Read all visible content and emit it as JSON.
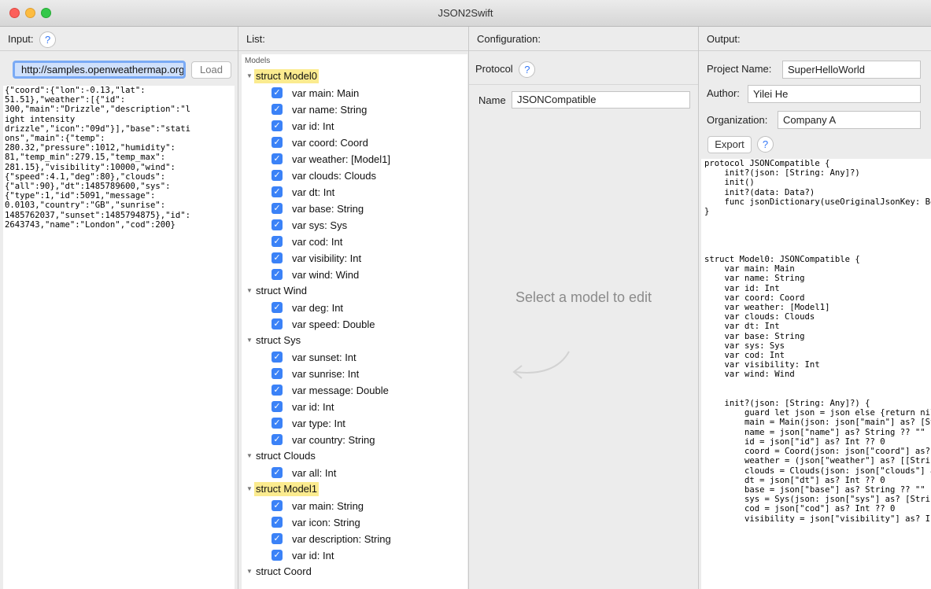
{
  "window": {
    "title": "JSON2Swift"
  },
  "input": {
    "header": "Input:",
    "url_value": "http://samples.openweathermap.org",
    "load_label": "Load",
    "json_text": "{\"coord\":{\"lon\":-0.13,\"lat\":\n51.51},\"weather\":[{\"id\":\n300,\"main\":\"Drizzle\",\"description\":\"l\night intensity\ndrizzle\",\"icon\":\"09d\"}],\"base\":\"stati\nons\",\"main\":{\"temp\":\n280.32,\"pressure\":1012,\"humidity\":\n81,\"temp_min\":279.15,\"temp_max\":\n281.15},\"visibility\":10000,\"wind\":\n{\"speed\":4.1,\"deg\":80},\"clouds\":\n{\"all\":90},\"dt\":1485789600,\"sys\":\n{\"type\":1,\"id\":5091,\"message\":\n0.0103,\"country\":\"GB\",\"sunrise\":\n1485762037,\"sunset\":1485794875},\"id\":\n2643743,\"name\":\"London\",\"cod\":200}"
  },
  "list": {
    "header": "List:",
    "caption": "Models",
    "rows": [
      {
        "kind": "struct",
        "label": "struct Model0",
        "highlight": true
      },
      {
        "kind": "prop",
        "label": "var main: Main",
        "checked": true
      },
      {
        "kind": "prop",
        "label": "var name: String",
        "checked": true
      },
      {
        "kind": "prop",
        "label": "var id: Int",
        "checked": true
      },
      {
        "kind": "prop",
        "label": "var coord: Coord",
        "checked": true
      },
      {
        "kind": "prop",
        "label": "var weather: [Model1]",
        "checked": true
      },
      {
        "kind": "prop",
        "label": "var clouds: Clouds",
        "checked": true
      },
      {
        "kind": "prop",
        "label": "var dt: Int",
        "checked": true
      },
      {
        "kind": "prop",
        "label": "var base: String",
        "checked": true
      },
      {
        "kind": "prop",
        "label": "var sys: Sys",
        "checked": true
      },
      {
        "kind": "prop",
        "label": "var cod: Int",
        "checked": true
      },
      {
        "kind": "prop",
        "label": "var visibility: Int",
        "checked": true
      },
      {
        "kind": "prop",
        "label": "var wind: Wind",
        "checked": true
      },
      {
        "kind": "struct",
        "label": "struct Wind",
        "highlight": false
      },
      {
        "kind": "prop",
        "label": "var deg: Int",
        "checked": true
      },
      {
        "kind": "prop",
        "label": "var speed: Double",
        "checked": true
      },
      {
        "kind": "struct",
        "label": "struct Sys",
        "highlight": false
      },
      {
        "kind": "prop",
        "label": "var sunset: Int",
        "checked": true
      },
      {
        "kind": "prop",
        "label": "var sunrise: Int",
        "checked": true
      },
      {
        "kind": "prop",
        "label": "var message: Double",
        "checked": true
      },
      {
        "kind": "prop",
        "label": "var id: Int",
        "checked": true
      },
      {
        "kind": "prop",
        "label": "var type: Int",
        "checked": true
      },
      {
        "kind": "prop",
        "label": "var country: String",
        "checked": true
      },
      {
        "kind": "struct",
        "label": "struct Clouds",
        "highlight": false
      },
      {
        "kind": "prop",
        "label": "var all: Int",
        "checked": true
      },
      {
        "kind": "struct",
        "label": "struct Model1",
        "highlight": true
      },
      {
        "kind": "prop",
        "label": "var main: String",
        "checked": true
      },
      {
        "kind": "prop",
        "label": "var icon: String",
        "checked": true
      },
      {
        "kind": "prop",
        "label": "var description: String",
        "checked": true
      },
      {
        "kind": "prop",
        "label": "var id: Int",
        "checked": true
      },
      {
        "kind": "struct",
        "label": "struct Coord",
        "highlight": false
      }
    ]
  },
  "configuration": {
    "header": "Configuration:",
    "protocol_label": "Protocol",
    "name_label": "Name",
    "name_value": "JSONCompatible",
    "placeholder": "Select a model to edit"
  },
  "output": {
    "header": "Output:",
    "project_label": "Project Name:",
    "project_value": "SuperHelloWorld",
    "author_label": "Author:",
    "author_value": "Yilei He",
    "org_label": "Organization:",
    "org_value": "Company A",
    "export_label": "Export",
    "code_text": "protocol JSONCompatible {\n    init?(json: [String: Any]?)\n    init()\n    init?(data: Data?)\n    func jsonDictionary(useOriginalJsonKey: Bool) -> [String: Any]\n}\n\n\n\n\nstruct Model0: JSONCompatible {\n    var main: Main\n    var name: String\n    var id: Int\n    var coord: Coord\n    var weather: [Model1]\n    var clouds: Clouds\n    var dt: Int\n    var base: String\n    var sys: Sys\n    var cod: Int\n    var visibility: Int\n    var wind: Wind\n\n\n    init?(json: [String: Any]?) {\n        guard let json = json else {return nil}\n        main = Main(json: json[\"main\"] as? [String: Any]) ?? Main()\n        name = json[\"name\"] as? String ?? \"\"\n        id = json[\"id\"] as? Int ?? 0\n        coord = Coord(json: json[\"coord\"] as? [String: Any]) ?? Coord()\n        weather = (json[\"weather\"] as? [[String: Any]] ?? []).flatMap{Model1(json: $0)}\n        clouds = Clouds(json: json[\"clouds\"] as? [String: Any]) ?? Clouds()\n        dt = json[\"dt\"] as? Int ?? 0\n        base = json[\"base\"] as? String ?? \"\"\n        sys = Sys(json: json[\"sys\"] as? [String: Any]) ?? Sys()\n        cod = json[\"cod\"] as? Int ?? 0\n        visibility = json[\"visibility\"] as? Int ?? 0"
  },
  "colors": {
    "accent": "#3b82f7",
    "highlight": "#fbeb8f"
  }
}
